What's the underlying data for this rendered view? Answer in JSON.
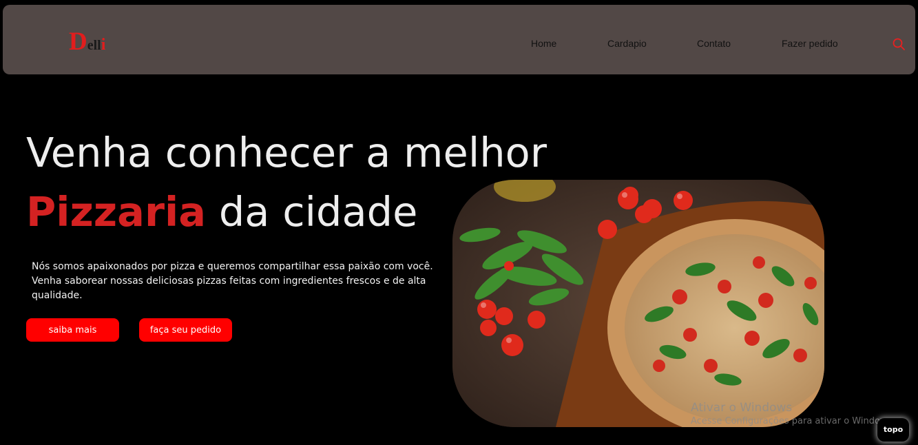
{
  "logo": {
    "first": "D",
    "middle": "ell",
    "last": "i"
  },
  "nav": {
    "home": "Home",
    "menu": "Cardapio",
    "contact": "Contato",
    "order": "Fazer pedido"
  },
  "icons": {
    "search": "search-icon"
  },
  "hero": {
    "line1": "Venha conhecer a melhor",
    "highlight": "Pizzaria",
    "line2_rest": " da cidade",
    "description": "Nós somos apaixonados por pizza e queremos compartilhar essa paixão com você. Venha saborear nossas deliciosas pizzas feitas com ingredientes frescos e de alta qualidade.",
    "btn_more": "saiba mais",
    "btn_order": "faça seu pedido"
  },
  "watermark": {
    "line1": "Ativar o Windows",
    "line2": "Acesse Configurações para ativar o Windows."
  },
  "back_to_top": "topo",
  "colors": {
    "accent": "#ff0000",
    "navbar": "#524846",
    "background": "#000000",
    "highlight": "#d42222"
  }
}
